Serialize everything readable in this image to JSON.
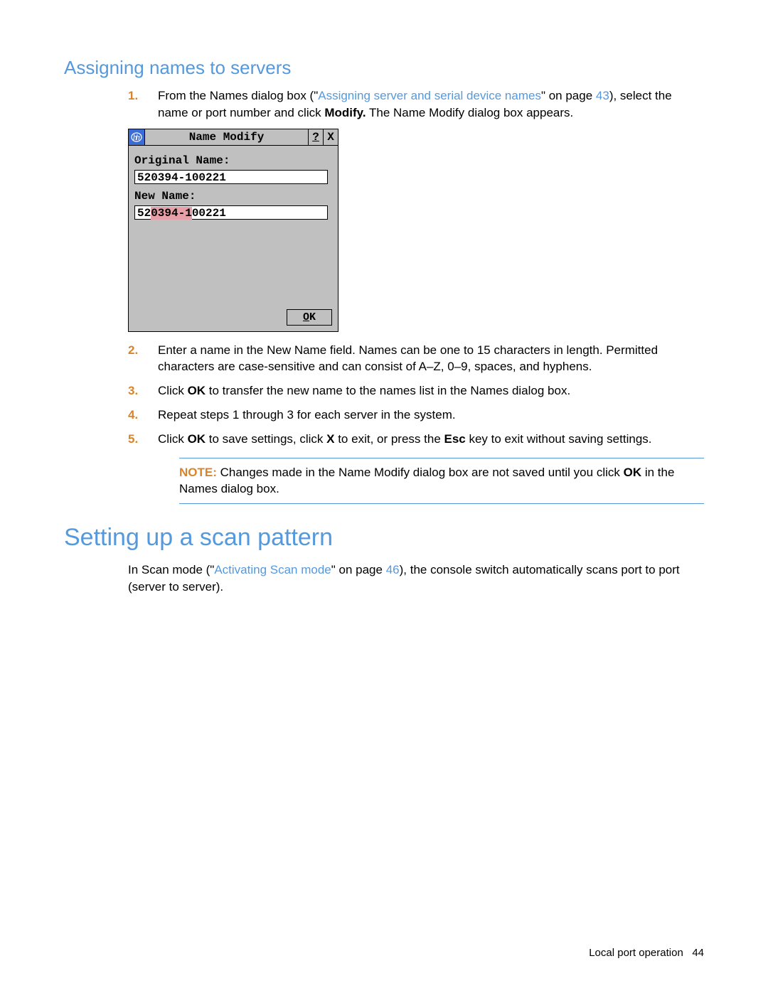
{
  "section1": {
    "title": "Assigning names to servers",
    "step1_a": "From the Names dialog box (\"",
    "step1_link": "Assigning server and serial device names",
    "step1_b": "\" on page ",
    "step1_page": "43",
    "step1_c": "), select the name or port number and click ",
    "step1_bold": "Modify.",
    "step1_d": " The Name Modify dialog box appears.",
    "step2": "Enter a name in the New Name field. Names can be one to 15 characters in length. Permitted characters are case-sensitive and can consist of A–Z, 0–9, spaces, and hyphens.",
    "step3_a": "Click ",
    "step3_bold": "OK",
    "step3_b": " to transfer the new name to the names list in the Names dialog box.",
    "step4": "Repeat steps 1 through 3 for each server in the system.",
    "step5_a": "Click ",
    "step5_b1": "OK",
    "step5_c": " to save settings, click ",
    "step5_b2": "X",
    "step5_d": " to exit, or press the ",
    "step5_b3": "Esc",
    "step5_e": " key to exit without saving settings.",
    "note_label": "NOTE:",
    "note_a": "  Changes made in the Name Modify dialog box are not saved until you click ",
    "note_bold": "OK",
    "note_b": " in the Names dialog box."
  },
  "dialog": {
    "title": "Name Modify",
    "help": "?",
    "close": "X",
    "label_original": "Original Name:",
    "value_original": "520394-100221",
    "label_new_a": "N",
    "label_new_b": "ew Name:",
    "value_new_pre": "52",
    "value_new_sel": "0394-1",
    "value_new_post": "00221",
    "ok_u": "O",
    "ok_rest": "K"
  },
  "section2": {
    "title": "Setting up a scan pattern",
    "body_a": "In Scan mode (\"",
    "body_link": "Activating Scan mode",
    "body_b": "\" on page ",
    "body_page": "46",
    "body_c": "), the console switch automatically scans port to port (server to server)."
  },
  "footer": {
    "text": "Local port operation",
    "page": "44"
  }
}
